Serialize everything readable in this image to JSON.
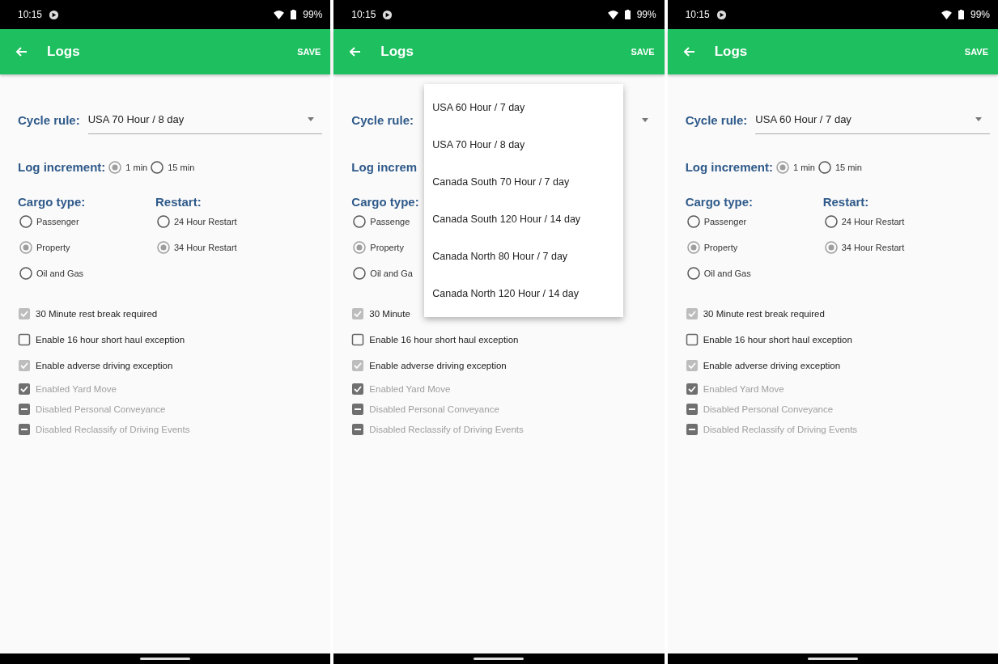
{
  "phones": [
    {
      "status_bar": {
        "time": "10:15",
        "battery": "99%"
      },
      "app_bar": {
        "title": "Logs",
        "action": "SAVE"
      },
      "cycle_rule": {
        "label": "Cycle rule:",
        "value": "USA 70 Hour / 8 day"
      },
      "log_increment": {
        "label": "Log increment:",
        "options": [
          {
            "label": "1 min",
            "selected": true
          },
          {
            "label": "15 min",
            "selected": false
          }
        ]
      },
      "cargo_type": {
        "label": "Cargo type:",
        "options": [
          {
            "label": "Passenger",
            "selected": false
          },
          {
            "label": "Property",
            "selected": true
          },
          {
            "label": "Oil and Gas",
            "selected": false
          }
        ]
      },
      "restart": {
        "label": "Restart:",
        "options": [
          {
            "label": "24 Hour Restart",
            "selected": false
          },
          {
            "label": "34 Hour Restart",
            "selected": true
          }
        ]
      },
      "checkboxes": [
        {
          "label": "30 Minute rest break required",
          "checked": true,
          "indeterminate": false,
          "disabled": false
        },
        {
          "label": "Enable 16 hour short haul exception",
          "checked": false,
          "indeterminate": false,
          "disabled": false
        },
        {
          "label": "Enable adverse driving exception",
          "checked": true,
          "indeterminate": false,
          "disabled": false
        },
        {
          "label": "Enabled Yard Move",
          "checked": true,
          "indeterminate": false,
          "disabled": true
        },
        {
          "label": "Disabled Personal Conveyance",
          "indeterminate": true,
          "disabled": true
        },
        {
          "label": "Disabled Reclassify of Driving Events",
          "indeterminate": true,
          "disabled": true
        }
      ]
    },
    {
      "status_bar": {
        "time": "10:15",
        "battery": "99%"
      },
      "app_bar": {
        "title": "Logs",
        "action": "SAVE"
      },
      "cycle_rule": {
        "label": "Cycle rule:"
      },
      "log_increment": {
        "label": "Log increm"
      },
      "cargo_type": {
        "label": "Cargo type:",
        "options": [
          {
            "label": "Passenge",
            "selected": false
          },
          {
            "label": "Property",
            "selected": true
          },
          {
            "label": "Oil and Ga",
            "selected": false
          }
        ]
      },
      "checkboxes": [
        {
          "label": "30 Minute",
          "checked": true,
          "indeterminate": false,
          "disabled": false
        },
        {
          "label": "Enable 16 hour short haul exception",
          "checked": false,
          "indeterminate": false,
          "disabled": false
        },
        {
          "label": "Enable adverse driving exception",
          "checked": true,
          "indeterminate": false,
          "disabled": false
        },
        {
          "label": "Enabled Yard Move",
          "checked": true,
          "indeterminate": false,
          "disabled": true
        },
        {
          "label": "Disabled Personal Conveyance",
          "indeterminate": true,
          "disabled": true
        },
        {
          "label": "Disabled Reclassify of Driving Events",
          "indeterminate": true,
          "disabled": true
        }
      ],
      "dropdown_menu": [
        "USA 60 Hour / 7 day",
        "USA 70 Hour / 8 day",
        "Canada South 70 Hour / 7 day",
        "Canada South 120 Hour / 14 day",
        "Canada North 80 Hour / 7 day",
        "Canada North 120 Hour / 14 day"
      ]
    },
    {
      "status_bar": {
        "time": "10:15",
        "battery": "99%"
      },
      "app_bar": {
        "title": "Logs",
        "action": "SAVE"
      },
      "cycle_rule": {
        "label": "Cycle rule:",
        "value": "USA 60 Hour / 7 day"
      },
      "log_increment": {
        "label": "Log increment:",
        "options": [
          {
            "label": "1 min",
            "selected": true
          },
          {
            "label": "15 min",
            "selected": false
          }
        ]
      },
      "cargo_type": {
        "label": "Cargo type:",
        "options": [
          {
            "label": "Passenger",
            "selected": false
          },
          {
            "label": "Property",
            "selected": true
          },
          {
            "label": "Oil and Gas",
            "selected": false
          }
        ]
      },
      "restart": {
        "label": "Restart:",
        "options": [
          {
            "label": "24 Hour Restart",
            "selected": false
          },
          {
            "label": "34 Hour Restart",
            "selected": true
          }
        ]
      },
      "checkboxes": [
        {
          "label": "30 Minute rest break required",
          "checked": true,
          "indeterminate": false,
          "disabled": false
        },
        {
          "label": "Enable 16 hour short haul exception",
          "checked": false,
          "indeterminate": false,
          "disabled": false
        },
        {
          "label": "Enable adverse driving exception",
          "checked": true,
          "indeterminate": false,
          "disabled": false
        },
        {
          "label": "Enabled Yard Move",
          "checked": true,
          "indeterminate": false,
          "disabled": true
        },
        {
          "label": "Disabled Personal Conveyance",
          "indeterminate": true,
          "disabled": true
        },
        {
          "label": "Disabled Reclassify of Driving Events",
          "indeterminate": true,
          "disabled": true
        }
      ]
    }
  ]
}
